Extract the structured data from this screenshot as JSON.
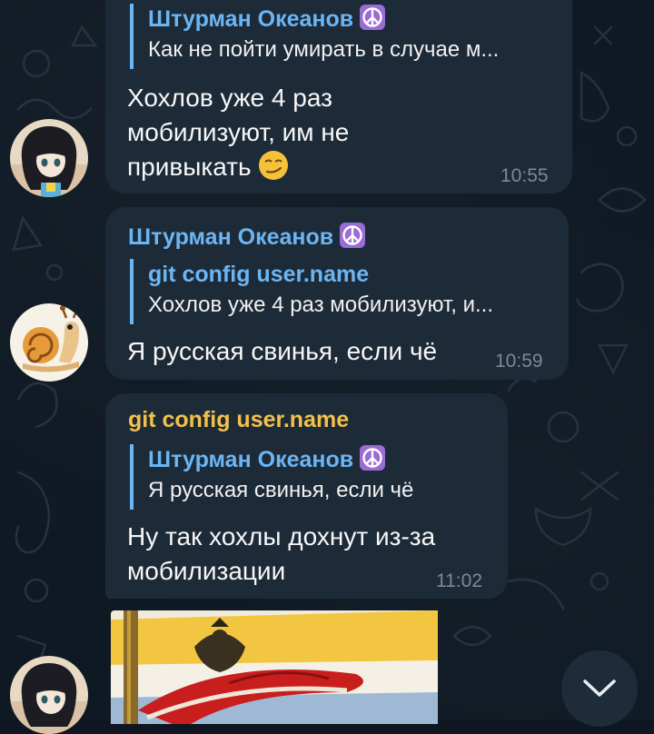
{
  "messages": [
    {
      "reply_to": {
        "name": "Штурман Океанов",
        "text": "Как не пойти умирать в случае м..."
      },
      "text_lines": [
        "Хохлов уже 4 раз",
        "мобилизуют, им не",
        "привыкать"
      ],
      "emoji": "smirk-emoji",
      "time": "10:55"
    },
    {
      "sender": "Штурман Океанов",
      "reply_to": {
        "name": "git config user.name",
        "text": "Хохлов уже 4 раз мобилизуют, и..."
      },
      "text": "Я русская свинья, если чё",
      "time": "10:59"
    },
    {
      "sender": "git config user.name",
      "reply_to": {
        "name": "Штурман Океанов",
        "text": "Я русская свинья, если чё"
      },
      "text_lines": [
        "Ну так хохлы дохнут из-за",
        "мобилизации"
      ],
      "time": "11:02"
    }
  ],
  "icons": {
    "peace": "peace-symbol-icon",
    "scroll_down": "chevron-down-icon"
  },
  "colors": {
    "background": "#0f1923",
    "bubble": "#1d2a37",
    "accent_blue": "#6cb5f3",
    "accent_gold": "#f3c14a",
    "peace_purple": "#9b6bd6",
    "time_gray": "#7a8a9a"
  }
}
